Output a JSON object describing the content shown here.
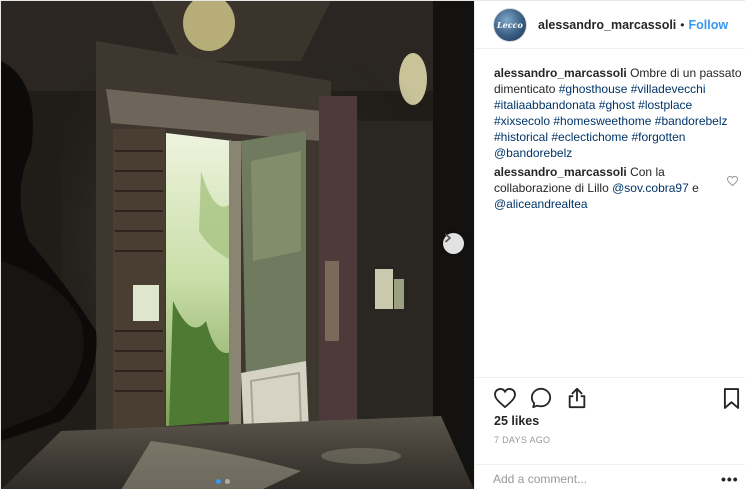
{
  "post": {
    "author": {
      "username": "alessandro_marcassoli",
      "avatar_text": "Lecco"
    },
    "separator": "•",
    "follow_label": "Follow",
    "comments": [
      {
        "user": "alessandro_marcassoli",
        "text": "Ombre di un passato dimenticato",
        "tags": [
          "#ghosthouse",
          "#villadevecchi",
          "#italiaabbandonata",
          "#ghost",
          "#lostplace",
          "#xixsecolo",
          "#homesweethome",
          "#bandorebelz",
          "#historical",
          "#eclectichome",
          "#forgotten"
        ],
        "mention": "@bandorebelz"
      },
      {
        "user": "alessandro_marcassoli",
        "text": "Con la collaborazione di Lillo",
        "mention1": "@sov.cobra97",
        "conj": "e",
        "mention2": "@aliceandrealtea"
      }
    ],
    "likes": "25 likes",
    "date": "7 DAYS AGO",
    "add_comment_placeholder": "Add a comment...",
    "more_label": "•••",
    "icons": {
      "like": "heart-icon",
      "comment": "comment-icon",
      "share": "share-icon",
      "save": "bookmark-icon",
      "next": "chevron-right-icon"
    },
    "colors": {
      "link": "#003569",
      "follow": "#3897f0",
      "text": "#262626",
      "muted": "#999999"
    },
    "carousel": {
      "count": 2,
      "active": 0
    }
  }
}
